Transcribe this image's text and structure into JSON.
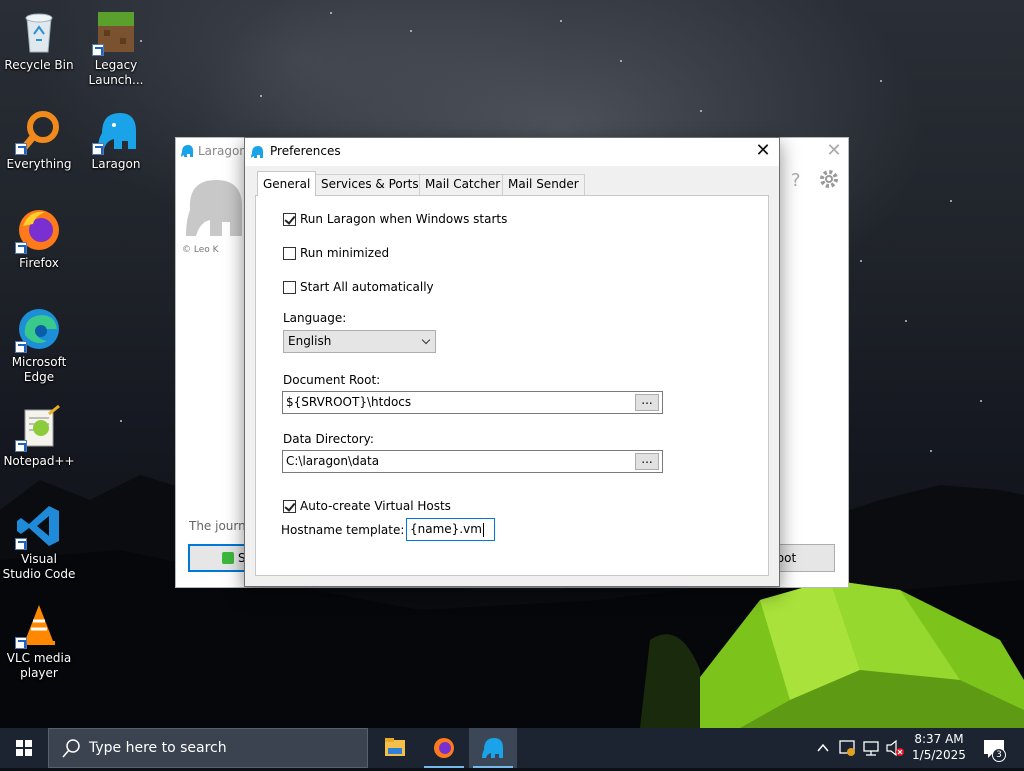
{
  "desktop": {
    "icons": [
      {
        "label": "Recycle Bin",
        "icon": "recycle-bin-icon"
      },
      {
        "label": "Legacy Launch...",
        "icon": "minecraft-icon"
      },
      {
        "label": "Everything",
        "icon": "everything-search-icon"
      },
      {
        "label": "Laragon",
        "icon": "laragon-elephant-icon"
      },
      {
        "label": "Firefox",
        "icon": "firefox-icon"
      },
      {
        "label": "Microsoft Edge",
        "icon": "edge-icon"
      },
      {
        "label": "Notepad++",
        "icon": "notepadpp-icon"
      },
      {
        "label": "Visual Studio Code",
        "icon": "vscode-icon"
      },
      {
        "label": "VLC media player",
        "icon": "vlc-icon"
      }
    ]
  },
  "laragon_window": {
    "title": "Laragon",
    "copyright": "© Leo K",
    "journey_text": "The journe",
    "start_button_label": "S",
    "root_button_label": "Root"
  },
  "preferences": {
    "title": "Preferences",
    "tabs": [
      "General",
      "Services & Ports",
      "Mail Catcher",
      "Mail Sender"
    ],
    "active_tab": "General",
    "run_on_startup": {
      "label": "Run Laragon when Windows starts",
      "checked": true
    },
    "run_minimized": {
      "label": "Run minimized",
      "checked": false
    },
    "start_all": {
      "label": "Start All automatically",
      "checked": false
    },
    "language": {
      "label": "Language:",
      "value": "English"
    },
    "document_root": {
      "label": "Document Root:",
      "value": "${SRVROOT}\\htdocs",
      "browse_label": "..."
    },
    "data_directory": {
      "label": "Data Directory:",
      "value": "C:\\laragon\\data",
      "browse_label": "..."
    },
    "auto_virtual_hosts": {
      "label": "Auto-create Virtual Hosts",
      "checked": true
    },
    "hostname_template": {
      "label": "Hostname template:",
      "value": "{name}.vm"
    }
  },
  "taskbar": {
    "search_placeholder": "Type here to search",
    "apps": [
      "file-explorer-icon",
      "firefox-icon",
      "laragon-elephant-icon"
    ],
    "time": "8:37 AM",
    "date": "1/5/2025",
    "notification_count": "3"
  },
  "colors": {
    "accent": "#0078d7",
    "laragon_blue": "#1aa3e8",
    "taskbar": "#1b2430",
    "tent_green": "#8fd12a"
  }
}
